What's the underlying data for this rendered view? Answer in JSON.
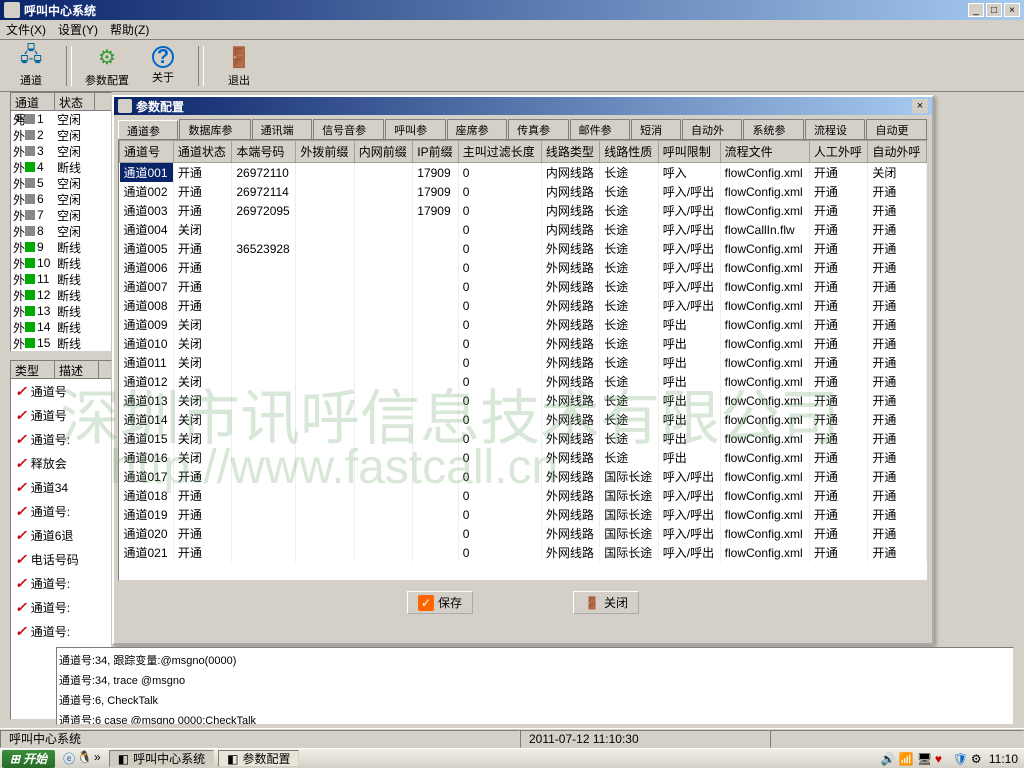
{
  "window": {
    "title": "呼叫中心系统"
  },
  "menus": [
    "文件(X)",
    "设置(Y)",
    "帮助(Z)"
  ],
  "toolbar": [
    {
      "label": "通道",
      "icon": "🖧"
    },
    {
      "label": "参数配置",
      "icon": "⚙"
    },
    {
      "label": "关于",
      "icon": "?"
    },
    {
      "label": "退出",
      "icon": "⎋"
    }
  ],
  "channel_list": {
    "headers": [
      "通道号",
      "状态"
    ],
    "rows": [
      {
        "no": "1",
        "status": "空闲",
        "color": "gray"
      },
      {
        "no": "2",
        "status": "空闲",
        "color": "gray"
      },
      {
        "no": "3",
        "status": "空闲",
        "color": "gray"
      },
      {
        "no": "4",
        "status": "断线",
        "color": "green"
      },
      {
        "no": "5",
        "status": "空闲",
        "color": "gray"
      },
      {
        "no": "6",
        "status": "空闲",
        "color": "gray"
      },
      {
        "no": "7",
        "status": "空闲",
        "color": "gray"
      },
      {
        "no": "8",
        "status": "空闲",
        "color": "gray"
      },
      {
        "no": "9",
        "status": "断线",
        "color": "green"
      },
      {
        "no": "10",
        "status": "断线",
        "color": "green"
      },
      {
        "no": "11",
        "status": "断线",
        "color": "green"
      },
      {
        "no": "12",
        "status": "断线",
        "color": "green"
      },
      {
        "no": "13",
        "status": "断线",
        "color": "green"
      },
      {
        "no": "14",
        "status": "断线",
        "color": "green"
      },
      {
        "no": "15",
        "status": "断线",
        "color": "green"
      }
    ]
  },
  "type_list": {
    "headers": [
      "类型",
      "描述"
    ],
    "rows": [
      "通道号",
      "通道号",
      "通道号:",
      "释放会",
      "通道34",
      "通道号:",
      "通道6退",
      "电话号码",
      "通道号:",
      "通道号:",
      "通道号:"
    ]
  },
  "dialog": {
    "title": "参数配置",
    "tabs": [
      "通道参数",
      "数据库参数",
      "通讯端口",
      "信号音参数",
      "呼叫参数",
      "座席参数",
      "传真参数",
      "邮件参数",
      "短消息",
      "自动外呼",
      "系统参数",
      "流程设置",
      "自动更新"
    ],
    "active_tab": 0,
    "columns": [
      "通道号",
      "通道状态",
      "本端号码",
      "外拨前缀",
      "内网前缀",
      "IP前缀",
      "主叫过滤长度",
      "线路类型",
      "线路性质",
      "呼叫限制",
      "流程文件",
      "人工外呼",
      "自动外呼"
    ],
    "rows": [
      {
        "ch": "通道001",
        "st": "开通",
        "num": "26972110",
        "ip": "17909",
        "len": "0",
        "ltype": "内网线路",
        "lnat": "长途",
        "lim": "呼入",
        "flow": "flowConfig.xml",
        "man": "开通",
        "auto": "关闭",
        "sel": true
      },
      {
        "ch": "通道002",
        "st": "开通",
        "num": "26972114",
        "ip": "17909",
        "len": "0",
        "ltype": "内网线路",
        "lnat": "长途",
        "lim": "呼入/呼出",
        "flow": "flowConfig.xml",
        "man": "开通",
        "auto": "开通"
      },
      {
        "ch": "通道003",
        "st": "开通",
        "num": "26972095",
        "ip": "17909",
        "len": "0",
        "ltype": "内网线路",
        "lnat": "长途",
        "lim": "呼入/呼出",
        "flow": "flowConfig.xml",
        "man": "开通",
        "auto": "开通"
      },
      {
        "ch": "通道004",
        "st": "关闭",
        "num": "",
        "ip": "",
        "len": "0",
        "ltype": "内网线路",
        "lnat": "长途",
        "lim": "呼入/呼出",
        "flow": "flowCallIn.flw",
        "man": "开通",
        "auto": "开通"
      },
      {
        "ch": "通道005",
        "st": "开通",
        "num": "36523928",
        "ip": "",
        "len": "0",
        "ltype": "外网线路",
        "lnat": "长途",
        "lim": "呼入/呼出",
        "flow": "flowConfig.xml",
        "man": "开通",
        "auto": "开通"
      },
      {
        "ch": "通道006",
        "st": "开通",
        "num": "",
        "ip": "",
        "len": "0",
        "ltype": "外网线路",
        "lnat": "长途",
        "lim": "呼入/呼出",
        "flow": "flowConfig.xml",
        "man": "开通",
        "auto": "开通"
      },
      {
        "ch": "通道007",
        "st": "开通",
        "num": "",
        "ip": "",
        "len": "0",
        "ltype": "外网线路",
        "lnat": "长途",
        "lim": "呼入/呼出",
        "flow": "flowConfig.xml",
        "man": "开通",
        "auto": "开通"
      },
      {
        "ch": "通道008",
        "st": "开通",
        "num": "",
        "ip": "",
        "len": "0",
        "ltype": "外网线路",
        "lnat": "长途",
        "lim": "呼入/呼出",
        "flow": "flowConfig.xml",
        "man": "开通",
        "auto": "开通"
      },
      {
        "ch": "通道009",
        "st": "关闭",
        "num": "",
        "ip": "",
        "len": "0",
        "ltype": "外网线路",
        "lnat": "长途",
        "lim": "呼出",
        "flow": "flowConfig.xml",
        "man": "开通",
        "auto": "开通"
      },
      {
        "ch": "通道010",
        "st": "关闭",
        "num": "",
        "ip": "",
        "len": "0",
        "ltype": "外网线路",
        "lnat": "长途",
        "lim": "呼出",
        "flow": "flowConfig.xml",
        "man": "开通",
        "auto": "开通"
      },
      {
        "ch": "通道011",
        "st": "关闭",
        "num": "",
        "ip": "",
        "len": "0",
        "ltype": "外网线路",
        "lnat": "长途",
        "lim": "呼出",
        "flow": "flowConfig.xml",
        "man": "开通",
        "auto": "开通"
      },
      {
        "ch": "通道012",
        "st": "关闭",
        "num": "",
        "ip": "",
        "len": "0",
        "ltype": "外网线路",
        "lnat": "长途",
        "lim": "呼出",
        "flow": "flowConfig.xml",
        "man": "开通",
        "auto": "开通"
      },
      {
        "ch": "通道013",
        "st": "关闭",
        "num": "",
        "ip": "",
        "len": "0",
        "ltype": "外网线路",
        "lnat": "长途",
        "lim": "呼出",
        "flow": "flowConfig.xml",
        "man": "开通",
        "auto": "开通"
      },
      {
        "ch": "通道014",
        "st": "关闭",
        "num": "",
        "ip": "",
        "len": "0",
        "ltype": "外网线路",
        "lnat": "长途",
        "lim": "呼出",
        "flow": "flowConfig.xml",
        "man": "开通",
        "auto": "开通"
      },
      {
        "ch": "通道015",
        "st": "关闭",
        "num": "",
        "ip": "",
        "len": "0",
        "ltype": "外网线路",
        "lnat": "长途",
        "lim": "呼出",
        "flow": "flowConfig.xml",
        "man": "开通",
        "auto": "开通"
      },
      {
        "ch": "通道016",
        "st": "关闭",
        "num": "",
        "ip": "",
        "len": "0",
        "ltype": "外网线路",
        "lnat": "长途",
        "lim": "呼出",
        "flow": "flowConfig.xml",
        "man": "开通",
        "auto": "开通"
      },
      {
        "ch": "通道017",
        "st": "开通",
        "num": "",
        "ip": "",
        "len": "0",
        "ltype": "外网线路",
        "lnat": "国际长途",
        "lim": "呼入/呼出",
        "flow": "flowConfig.xml",
        "man": "开通",
        "auto": "开通"
      },
      {
        "ch": "通道018",
        "st": "开通",
        "num": "",
        "ip": "",
        "len": "0",
        "ltype": "外网线路",
        "lnat": "国际长途",
        "lim": "呼入/呼出",
        "flow": "flowConfig.xml",
        "man": "开通",
        "auto": "开通"
      },
      {
        "ch": "通道019",
        "st": "开通",
        "num": "",
        "ip": "",
        "len": "0",
        "ltype": "外网线路",
        "lnat": "国际长途",
        "lim": "呼入/呼出",
        "flow": "flowConfig.xml",
        "man": "开通",
        "auto": "开通"
      },
      {
        "ch": "通道020",
        "st": "开通",
        "num": "",
        "ip": "",
        "len": "0",
        "ltype": "外网线路",
        "lnat": "国际长途",
        "lim": "呼入/呼出",
        "flow": "flowConfig.xml",
        "man": "开通",
        "auto": "开通"
      },
      {
        "ch": "通道021",
        "st": "开通",
        "num": "",
        "ip": "",
        "len": "0",
        "ltype": "外网线路",
        "lnat": "国际长途",
        "lim": "呼入/呼出",
        "flow": "flowConfig.xml",
        "man": "开通",
        "auto": "开通"
      }
    ],
    "save_btn": "保存",
    "close_btn": "关闭"
  },
  "logs": [
    "通道号:34, 跟踪变量:@msgno(0000)",
    "通道号:34, trace @msgno",
    "通道号:6, CheckTalk",
    "通道号:6  case @msgno 0000:CheckTalk"
  ],
  "status_bar": {
    "app": "呼叫中心系统",
    "time": "2011-07-12 11:10:30"
  },
  "taskbar": {
    "start": "开始",
    "items": [
      "呼叫中心系统",
      "参数配置"
    ],
    "clock": "11:10"
  },
  "watermark": {
    "line1": "深圳市讯呼信息技术有限公司",
    "line2": "http://www.fastcall.cn"
  }
}
